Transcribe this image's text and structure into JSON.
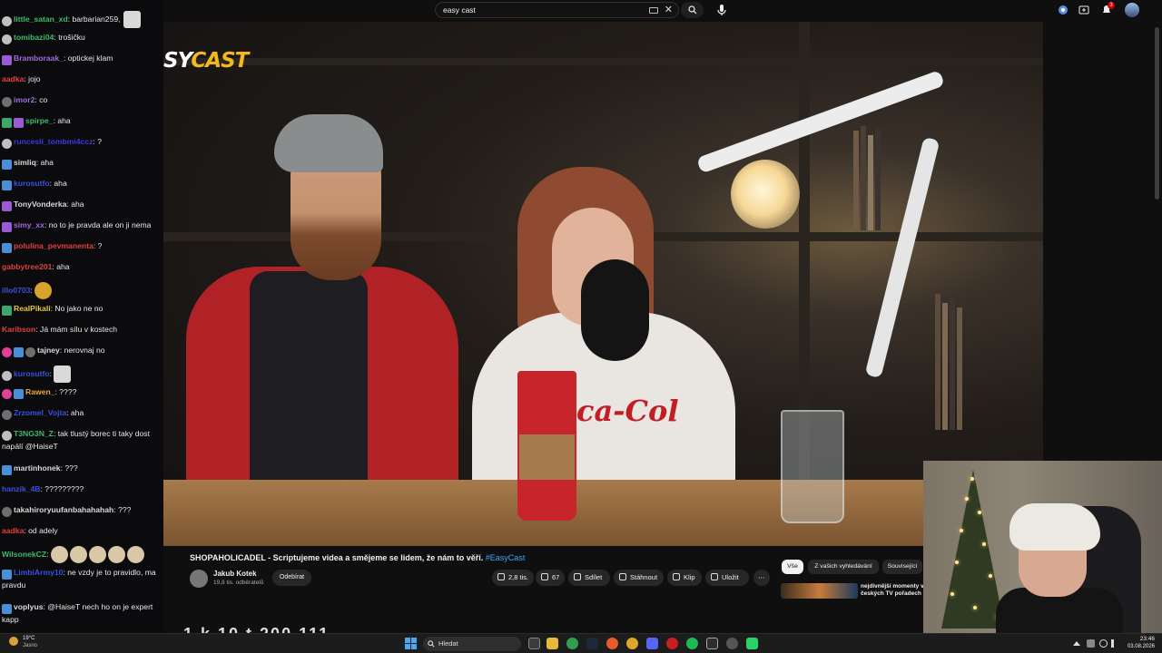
{
  "chat": {
    "messages": [
      {
        "user": "little_satan_xd",
        "user_color": "#3fb96a",
        "text": "barbarian259,",
        "badges": [
          "circle"
        ],
        "emote": "card"
      },
      {
        "user": "tomibazi04",
        "user_color": "#3fb96a",
        "text": "trošičku",
        "badges": [
          "circle"
        ]
      },
      {
        "user": "Bramboraak_",
        "user_color": "#a06ae0",
        "text": "optickej klam",
        "badges": [
          "purple"
        ]
      },
      {
        "user": "aadka",
        "user_color": "#e04040",
        "text": "jojo",
        "badges": []
      },
      {
        "user": "imor2",
        "user_color": "#a06ae0",
        "text": "co",
        "badges": [
          "gray"
        ]
      },
      {
        "user": "spirpe_",
        "user_color": "#3fb96a",
        "text": "aha",
        "badges": [
          "green",
          "purple"
        ]
      },
      {
        "user": "runcesli_tombmi4ccz",
        "user_color": "#3a3ae0",
        "text": "?",
        "badges": [
          "circle"
        ]
      },
      {
        "user": "simliq",
        "user_color": "#d9d9d9",
        "text": "aha",
        "badges": [
          "square"
        ]
      },
      {
        "user": "kurosutfo",
        "user_color": "#3a4fe0",
        "text": "aha",
        "badges": [
          "square"
        ]
      },
      {
        "user": "TonyVonderka",
        "user_color": "#d9d9d9",
        "text": "aha",
        "badges": [
          "purple"
        ]
      },
      {
        "user": "simy_xx",
        "user_color": "#a06ae0",
        "text": "no to je pravda ale on ji nema",
        "badges": [
          "purple"
        ]
      },
      {
        "user": "polulina_pevmanenta",
        "user_color": "#e04040",
        "text": "?",
        "badges": [
          "square"
        ]
      },
      {
        "user": "gabbytree201",
        "user_color": "#e04040",
        "text": "aha",
        "badges": []
      },
      {
        "user": "illo0703",
        "user_color": "#3a4fe0",
        "text": "",
        "badges": [],
        "emote": "gold"
      },
      {
        "user": "RealPikali",
        "user_color": "#e8c840",
        "text": "No jako ne no",
        "badges": [
          "green"
        ]
      },
      {
        "user": "Karibson",
        "user_color": "#e04040",
        "text": "Já mám sílu v kostech",
        "badges": []
      },
      {
        "user": "tajney",
        "user_color": "#d9d9d9",
        "text": "nerovnaj no",
        "badges": [
          "pink",
          "square",
          "gray"
        ]
      },
      {
        "user": "kurosutfo",
        "user_color": "#3a4fe0",
        "text": "",
        "badges": [
          "circle"
        ],
        "emote": "card"
      },
      {
        "user": "Rawen_",
        "user_color": "#e8a840",
        "text": "????",
        "badges": [
          "pink",
          "square"
        ]
      },
      {
        "user": "Zrzomel_Vojta",
        "user_color": "#3a4fe0",
        "text": "aha",
        "badges": [
          "gray"
        ]
      },
      {
        "user": "T3NG3N_Z",
        "user_color": "#3fb96a",
        "text": "tak tlustý borec ti taky dost napálí @HaiseT",
        "badges": [
          "circle"
        ]
      },
      {
        "user": "martinhonek",
        "user_color": "#d9d9d9",
        "text": "???",
        "badges": [
          "square"
        ]
      },
      {
        "user": "hanzik_4B",
        "user_color": "#3a4fe0",
        "text": "?????????",
        "badges": []
      },
      {
        "user": "takahiroryuufanbahahahah",
        "user_color": "#d9d9d9",
        "text": "???",
        "badges": [
          "gray"
        ]
      },
      {
        "user": "aadka",
        "user_color": "#e04040",
        "text": "od adely",
        "badges": []
      },
      {
        "user": "WilsonekCZ",
        "user_color": "#3fb96a",
        "text": "",
        "badges": [],
        "emotes_count": 5
      },
      {
        "user": "LimbiArmy10",
        "user_color": "#3a4fe0",
        "text": "ne vzdy je to pravidlo, ma pravdu",
        "badges": [
          "square"
        ]
      },
      {
        "user": "voplyus",
        "user_color": "#d9d9d9",
        "text": "@HaiseT nech ho on je expert kapp",
        "badges": [
          "square"
        ]
      }
    ]
  },
  "search": {
    "query": "easy cast"
  },
  "video": {
    "logo_left": "SY",
    "logo_right": "CAST",
    "shirt_text": "ca-Col",
    "title_main": "SHOPAHOLICADEL - Scriptujeme videa a smějeme se lidem, že nám to věří.",
    "hashtag": "#EasyCast",
    "channel": "Jakub Kotek",
    "subscribers": "19,8 tis. odběratelů",
    "unsubscribe": "Odebírat",
    "likes": "2,8 tis.",
    "dislikes": "67",
    "share": "Sdílet",
    "download": "Stáhnout",
    "clip": "Klip",
    "save": "Uložit",
    "more": "⋯",
    "below_text": "1 k   10 t    200 111"
  },
  "recommendations": {
    "chips": [
      "Vše",
      "Z vašich vyhledávání",
      "Související"
    ],
    "item_title": "nejdivnější momenty v českých TV pořadech"
  },
  "notifications": {
    "count": "3"
  },
  "taskbar": {
    "weather_temp": "19°C",
    "weather_cond": "Jasno",
    "search_label": "Hledat",
    "time": "23:46",
    "date": "03.08.2026"
  }
}
